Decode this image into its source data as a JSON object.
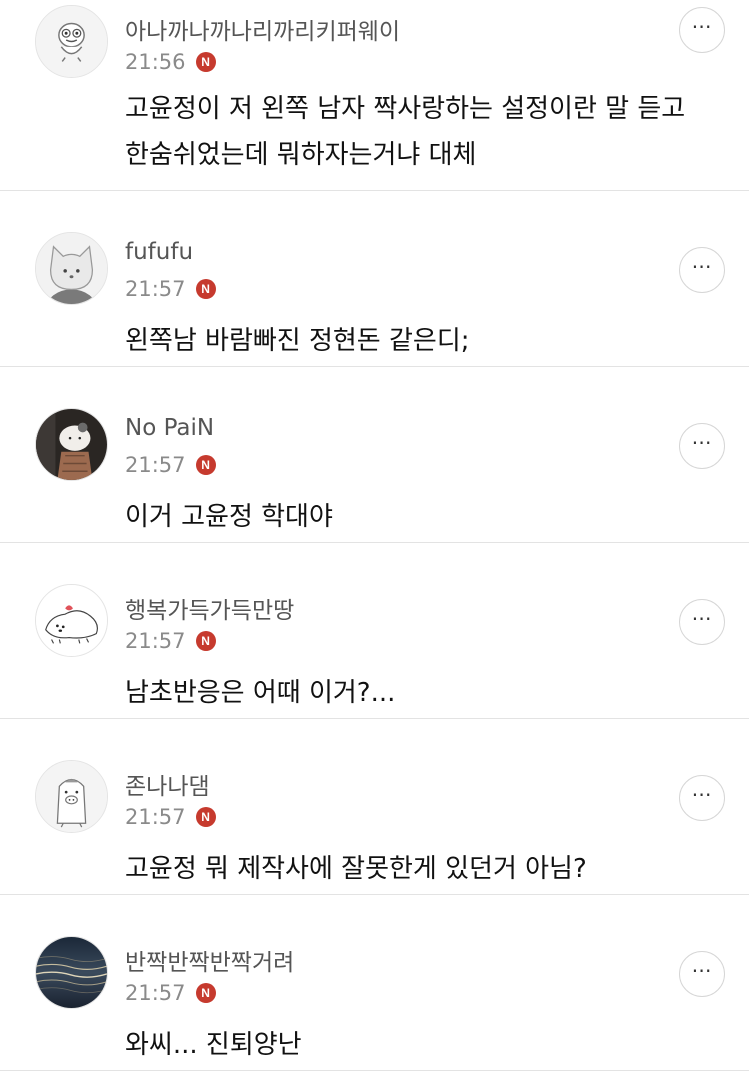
{
  "comments": [
    {
      "author": "아나까나까나리까리키퍼웨이",
      "time": "21:56",
      "badge": "N",
      "text": "고윤정이 저 왼쪽 남자 짝사랑하는 설정이란 말 듣고 한숨쉬었는데 뭐하자는거냐 대체",
      "avatar_icon": "duck-character-icon"
    },
    {
      "author": "fufufu",
      "time": "21:57",
      "badge": "N",
      "text": "왼쪽남 바람빠진 정현돈 같은디;",
      "avatar_icon": "cat-character-icon"
    },
    {
      "author": "No PaiN",
      "time": "21:57",
      "badge": "N",
      "text": "이거 고윤정 학대야",
      "avatar_icon": "hello-kitty-photo-icon"
    },
    {
      "author": "행복가득가득만땅",
      "time": "21:57",
      "badge": "N",
      "text": "남초반응은 어때 이거?...",
      "avatar_icon": "puppy-drawing-icon"
    },
    {
      "author": "존나나댐",
      "time": "21:57",
      "badge": "N",
      "text": "고윤정 뭐 제작사에 잘못한게 있던거 아님?",
      "avatar_icon": "penguin-character-icon"
    },
    {
      "author": "반짝반짝반짝거려",
      "time": "21:57",
      "badge": "N",
      "text": "와씨... 진퇴양난",
      "avatar_icon": "sparkling-water-photo-icon"
    }
  ],
  "more_icon": "⋯"
}
